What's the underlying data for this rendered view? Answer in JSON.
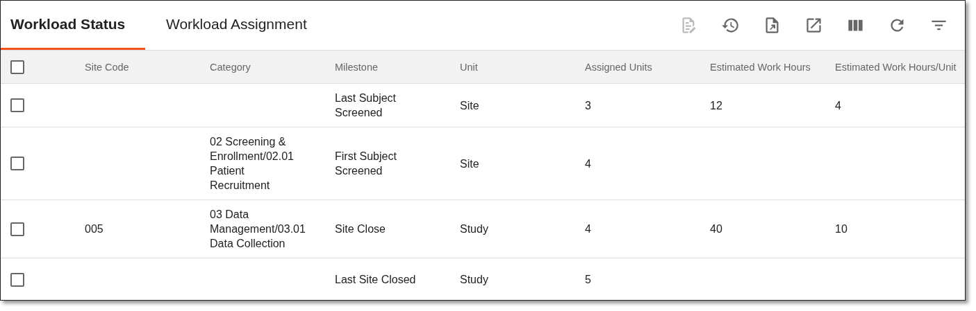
{
  "tabs": [
    {
      "label": "Workload Status",
      "selected": true
    },
    {
      "label": "Workload Assignment",
      "selected": false
    }
  ],
  "toolbar": [
    {
      "kind": "edit-doc",
      "disabled": true
    },
    {
      "kind": "history",
      "disabled": false
    },
    {
      "kind": "export",
      "disabled": false
    },
    {
      "kind": "open-external",
      "disabled": false
    },
    {
      "kind": "columns",
      "disabled": false
    },
    {
      "kind": "refresh",
      "disabled": false
    },
    {
      "kind": "filter",
      "disabled": false
    }
  ],
  "table": {
    "select_all_checked": false,
    "columns": [
      "Site Code",
      "Category",
      "Milestone",
      "Unit",
      "Assigned Units",
      "Estimated Work Hours",
      "Estimated Work Hours/Unit"
    ],
    "rows": [
      {
        "checked": false,
        "cells": [
          "",
          "",
          "Last Subject Screened",
          "Site",
          "3",
          "12",
          "4"
        ]
      },
      {
        "checked": false,
        "cells": [
          "",
          "02 Screening & Enrollment/02.01 Patient Recruitment",
          "First Subject Screened",
          "Site",
          "4",
          "",
          ""
        ]
      },
      {
        "checked": false,
        "cells": [
          "005",
          "03 Data Management/03.01 Data Collection",
          "Site Close",
          "Study",
          "4",
          "40",
          "10"
        ]
      },
      {
        "checked": false,
        "cells": [
          "",
          "",
          "Last Site Closed",
          "Study",
          "5",
          "",
          ""
        ]
      }
    ]
  }
}
